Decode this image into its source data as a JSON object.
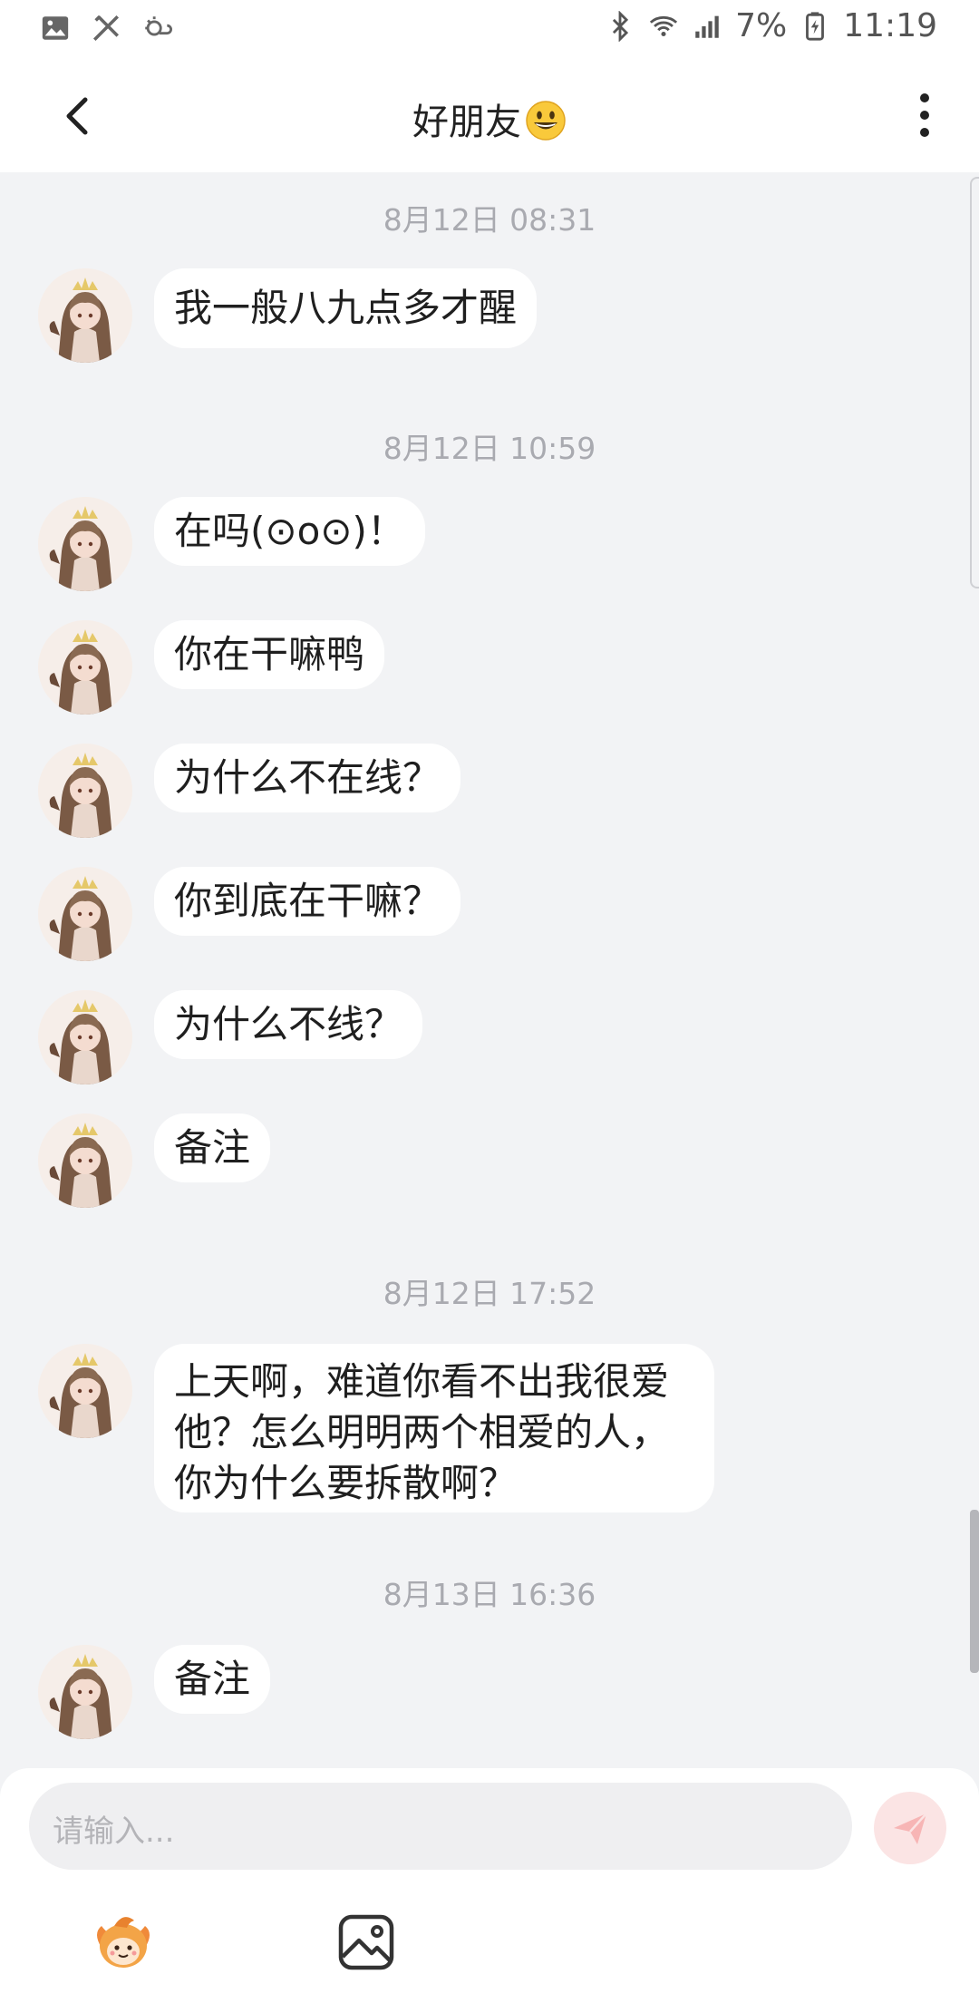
{
  "status_bar": {
    "battery_percent": "7%",
    "time": "11:19"
  },
  "header": {
    "title": "好朋友",
    "title_emoji_icon": "grinning-face-emoji",
    "back_icon": "chevron-left-icon",
    "more_icon": "more-vertical-icon"
  },
  "messages": [
    {
      "type": "timestamp",
      "text": "8月12日 08:31"
    },
    {
      "type": "incoming",
      "text": "我一般八九点多才醒"
    },
    {
      "type": "timestamp",
      "text": "8月12日 10:59"
    },
    {
      "type": "incoming",
      "text": "在吗(⊙o⊙)！"
    },
    {
      "type": "incoming",
      "text": "你在干嘛鸭"
    },
    {
      "type": "incoming",
      "text": "为什么不在线？"
    },
    {
      "type": "incoming",
      "text": "你到底在干嘛？"
    },
    {
      "type": "incoming",
      "text": "为什么不线？"
    },
    {
      "type": "incoming",
      "text": "备注"
    },
    {
      "type": "timestamp",
      "text": "8月12日 17:52"
    },
    {
      "type": "incoming",
      "lines": [
        "上天啊，难道你看不出我很爱",
        "他？怎么明明两个相爱的人，",
        "你为什么要拆散啊？"
      ]
    },
    {
      "type": "timestamp",
      "text": "8月13日 16:36"
    },
    {
      "type": "incoming",
      "text": "备注"
    }
  ],
  "composer": {
    "placeholder": "请输入...",
    "send_icon": "send-paper-plane-icon",
    "tools": [
      {
        "name": "mascot-sticker-icon"
      },
      {
        "name": "image-picker-icon"
      }
    ]
  },
  "colors": {
    "background": "#f2f3f5",
    "bubble": "#ffffff",
    "timestamp": "#a9aab0",
    "send_button": "#fbe4e4",
    "accent": "#f07a7a"
  }
}
